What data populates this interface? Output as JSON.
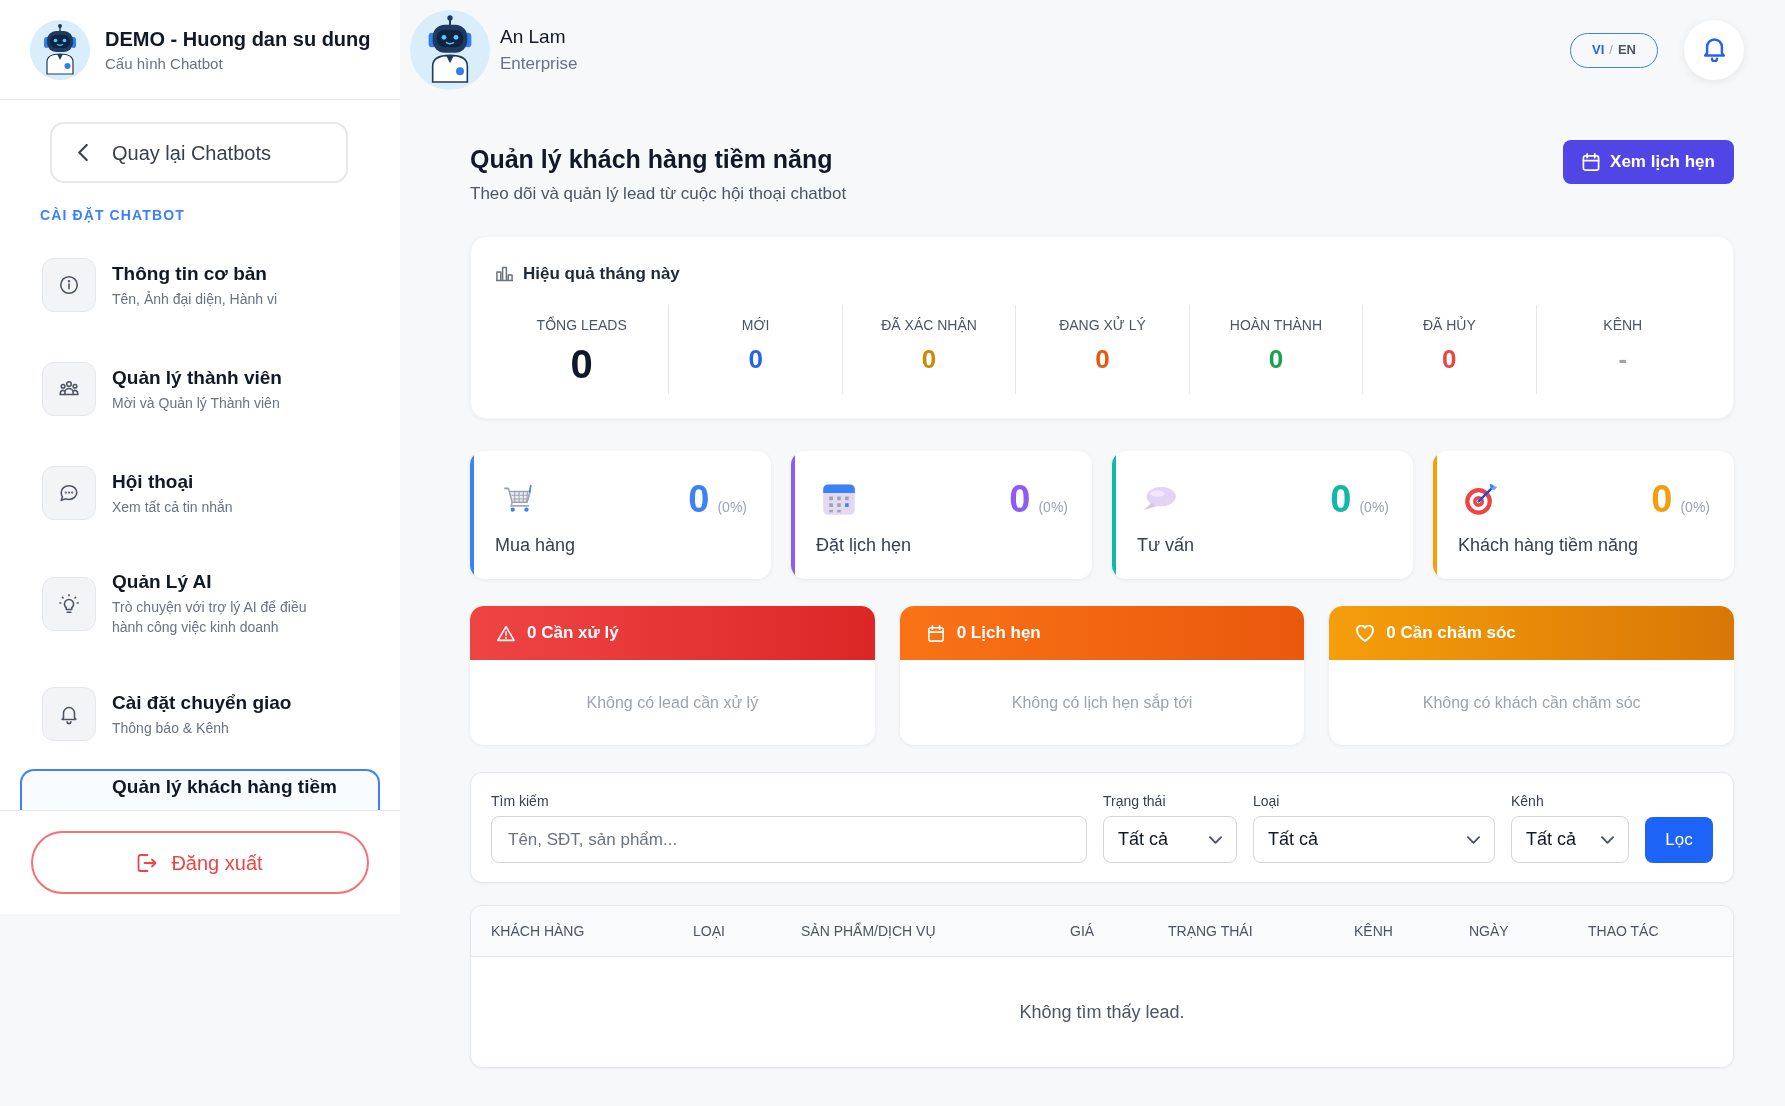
{
  "sidebar": {
    "header": {
      "title": "DEMO - Huong dan su dung",
      "subtitle": "Cấu hình Chatbot"
    },
    "back_button": {
      "label": "Quay lại Chatbots"
    },
    "section_label": "CÀI ĐẶT CHATBOT",
    "items": [
      {
        "kind": "info",
        "title": "Thông tin cơ bản",
        "description": "Tên, Ảnh đại diện, Hành vi",
        "selected": false
      },
      {
        "kind": "members",
        "title": "Quản lý thành viên",
        "description": "Mời và Quản lý Thành viên",
        "selected": false
      },
      {
        "kind": "chat",
        "title": "Hội thoại",
        "description": "Xem tất cả tin nhắn",
        "selected": false
      },
      {
        "kind": "ai",
        "title": "Quản Lý AI",
        "description": "Trò chuyện với trợ lý AI để điều hành công việc kinh doanh",
        "selected": false
      },
      {
        "kind": "handoff",
        "title": "Cài đặt chuyển giao",
        "description": "Thông báo & Kênh",
        "selected": false
      },
      {
        "kind": "leads",
        "title": "Quản lý khách hàng tiềm",
        "selected": true
      }
    ],
    "logout_button": {
      "label": "Đăng xuất"
    }
  },
  "header": {
    "user": {
      "name": "An Lam",
      "plan": "Enterprise"
    },
    "language": {
      "options": [
        {
          "label": "VI",
          "selected": true
        },
        {
          "label": "EN",
          "selected": false
        }
      ],
      "separator": "/"
    }
  },
  "page": {
    "title": "Quản lý khách hàng tiềm năng",
    "subtitle": "Theo dõi và quản lý lead từ cuộc hội thoại chatbot",
    "action_button": {
      "label": "Xem lịch hẹn"
    }
  },
  "stats": {
    "title": "Hiệu quả tháng này",
    "items": [
      {
        "kind": "total",
        "label": "TỔNG LEADS",
        "value": "0",
        "color": "#111827"
      },
      {
        "kind": "count",
        "label": "MỚI",
        "value": "0",
        "color": "#2563eb"
      },
      {
        "kind": "count",
        "label": "ĐÃ XÁC NHẬN",
        "value": "0",
        "color": "#ca8a04"
      },
      {
        "kind": "count",
        "label": "ĐANG XỬ LÝ",
        "value": "0",
        "color": "#ea580c"
      },
      {
        "kind": "count",
        "label": "HOÀN THÀNH",
        "value": "0",
        "color": "#16a34a"
      },
      {
        "kind": "count",
        "label": "ĐÃ HỦY",
        "value": "0",
        "color": "#ef4444"
      },
      {
        "kind": "count",
        "label": "KÊNH",
        "value": "-",
        "color": "#9ca3af"
      }
    ]
  },
  "categories": [
    {
      "kind": "cart",
      "label": "Mua hàng",
      "count": "0",
      "share": "(0%)",
      "color": "#3b82f6"
    },
    {
      "kind": "calendar",
      "label": "Đặt lịch hẹn",
      "count": "0",
      "share": "(0%)",
      "color": "#8b5cf6"
    },
    {
      "kind": "chat",
      "label": "Tư vấn",
      "count": "0",
      "share": "(0%)",
      "color": "#14b8a6"
    },
    {
      "kind": "target",
      "label": "Khách hàng tiềm năng",
      "count": "0",
      "share": "(0%)",
      "color": "#f59e0b"
    }
  ],
  "alerts": [
    {
      "kind": "urgent",
      "title": "0 Cần xử lý",
      "message": "Không có lead cần xử lý"
    },
    {
      "kind": "appointment",
      "title": "0 Lịch hẹn",
      "message": "Không có lịch hẹn sắp tới"
    },
    {
      "kind": "care",
      "title": "0 Cần chăm sóc",
      "message": "Không có khách cần chăm sóc"
    }
  ],
  "filters": {
    "search": {
      "label": "Tìm kiếm",
      "placeholder": "Tên, SĐT, sản phẩm..."
    },
    "selects": [
      {
        "label": "Trạng thái",
        "value": "Tất cả"
      },
      {
        "label": "Loại",
        "value": "Tất cả"
      },
      {
        "label": "Kênh",
        "value": "Tất cả"
      }
    ],
    "button": {
      "label": "Lọc"
    }
  },
  "table": {
    "columns": [
      "KHÁCH HÀNG",
      "LOẠI",
      "SẢN PHẨM/DỊCH VỤ",
      "GIÁ",
      "TRẠNG THÁI",
      "KÊNH",
      "NGÀY",
      "THAO TÁC"
    ],
    "empty_message": "Không tìm thấy lead."
  }
}
